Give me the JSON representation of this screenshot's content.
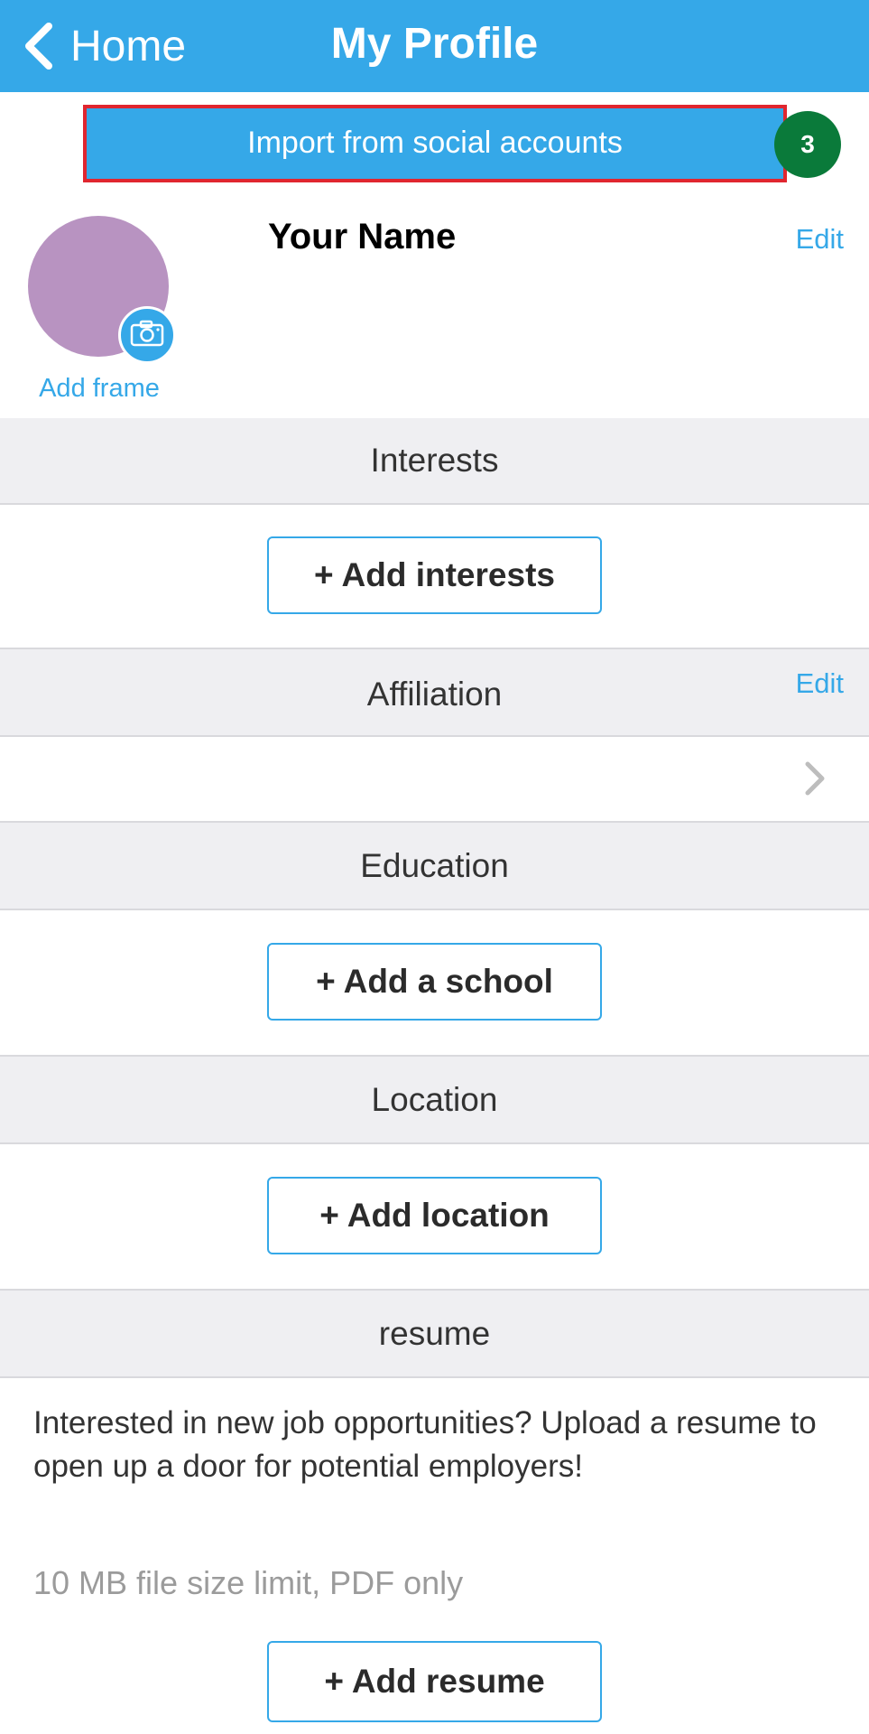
{
  "nav": {
    "back_label": "Home",
    "title": "My Profile",
    "back_icon": "chevron-left-icon"
  },
  "import": {
    "label": "Import from social accounts",
    "step_badge": "3"
  },
  "profile": {
    "name": "Your Name",
    "edit_label": "Edit",
    "add_frame_label": "Add frame",
    "camera_icon": "camera-icon",
    "avatar_color": "#b893c1"
  },
  "sections": {
    "interests": {
      "title": "Interests",
      "button": "+ Add interests"
    },
    "affiliation": {
      "title": "Affiliation",
      "edit_label": "Edit",
      "row_icon": "chevron-right-icon"
    },
    "education": {
      "title": "Education",
      "button": "+ Add a school"
    },
    "location": {
      "title": "Location",
      "button": "+ Add location"
    },
    "resume": {
      "title": "resume",
      "description": "Interested in new job opportunities? Upload a resume to open up a door for potential employers!",
      "note": "10 MB file size limit, PDF only",
      "button": "+ Add resume"
    }
  },
  "colors": {
    "accent": "#35a8e8",
    "highlight_border": "#e0262f",
    "badge": "#0a7a3a",
    "section_bg": "#efeff2"
  }
}
